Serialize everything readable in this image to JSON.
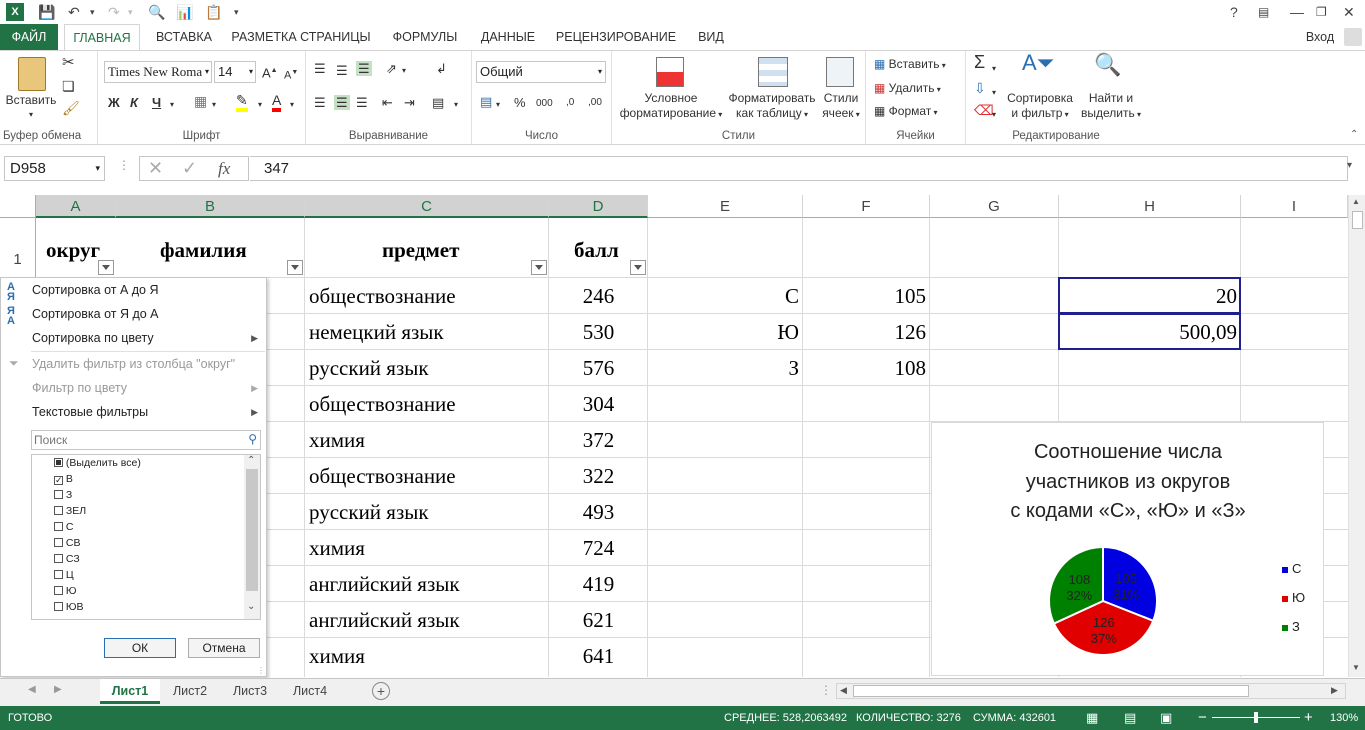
{
  "window": {
    "help": "?",
    "signin": "Вход"
  },
  "tabs": [
    "ФАЙЛ",
    "ГЛАВНАЯ",
    "ВСТАВКА",
    "РАЗМЕТКА СТРАНИЦЫ",
    "ФОРМУЛЫ",
    "ДАННЫЕ",
    "РЕЦЕНЗИРОВАНИЕ",
    "ВИД"
  ],
  "ribbon": {
    "clipboard": {
      "label": "Буфер обмена",
      "paste": "Вставить"
    },
    "font": {
      "label": "Шрифт",
      "name": "Times New Roma",
      "size": "14",
      "bold": "Ж",
      "italic": "К",
      "underline": "Ч"
    },
    "align": {
      "label": "Выравнивание"
    },
    "number": {
      "label": "Число",
      "format": "Общий",
      "percent": "%",
      "thousands": "000"
    },
    "styles": {
      "label": "Стили",
      "cond1": "Условное",
      "cond2": "форматирование",
      "tbl1": "Форматировать",
      "tbl2": "как таблицу",
      "cs1": "Стили",
      "cs2": "ячеек"
    },
    "cells": {
      "label": "Ячейки",
      "insert": "Вставить",
      "delete": "Удалить",
      "format": "Формат"
    },
    "editing": {
      "label": "Редактирование",
      "sort1": "Сортировка",
      "sort2": "и фильтр",
      "find1": "Найти и",
      "find2": "выделить"
    }
  },
  "formula": {
    "namebox": "D958",
    "value": "347"
  },
  "columns": [
    "A",
    "B",
    "C",
    "D",
    "E",
    "F",
    "G",
    "H",
    "I"
  ],
  "header_row": {
    "rownum": "1",
    "a": "округ",
    "b": "фамилия",
    "c": "предмет",
    "d": "балл"
  },
  "rows": [
    {
      "c": "обществознание",
      "d": "246"
    },
    {
      "c": "немецкий язык",
      "d": "530"
    },
    {
      "c": "русский язык",
      "d": "576"
    },
    {
      "c": "обществознание",
      "d": "304"
    },
    {
      "c": "химия",
      "d": "372"
    },
    {
      "c": "обществознание",
      "d": "322"
    },
    {
      "c": "русский язык",
      "d": "493"
    },
    {
      "c": "химия",
      "d": "724"
    },
    {
      "c": "английский язык",
      "d": "419"
    },
    {
      "c": "английский язык",
      "d": "621"
    },
    {
      "c": "химия",
      "d": "641"
    }
  ],
  "summary": [
    {
      "e": "С",
      "f": "105",
      "h": "20"
    },
    {
      "e": "Ю",
      "f": "126",
      "h": "500,09"
    },
    {
      "e": "З",
      "f": "108",
      "h": ""
    }
  ],
  "filter_menu": {
    "sort_az": "Сортировка от А до Я",
    "sort_za": "Сортировка от Я до А",
    "sort_color": "Сортировка по цвету",
    "clear": "Удалить фильтр из столбца \"округ\"",
    "by_color": "Фильтр по цвету",
    "text_filters": "Текстовые фильтры",
    "search_placeholder": "Поиск",
    "items": [
      {
        "label": "(Выделить все)",
        "state": "partial"
      },
      {
        "label": "В",
        "state": "checked"
      },
      {
        "label": "З",
        "state": "unchecked"
      },
      {
        "label": "ЗЕЛ",
        "state": "unchecked"
      },
      {
        "label": "С",
        "state": "unchecked"
      },
      {
        "label": "СВ",
        "state": "unchecked"
      },
      {
        "label": "СЗ",
        "state": "unchecked"
      },
      {
        "label": "Ц",
        "state": "unchecked"
      },
      {
        "label": "Ю",
        "state": "unchecked"
      },
      {
        "label": "ЮВ",
        "state": "unchecked"
      }
    ],
    "ok": "ОК",
    "cancel": "Отмена"
  },
  "chart_data": {
    "type": "pie",
    "title": "Соотношение числа участников из округов с кодами «С», «Ю» и «З»",
    "title_lines": [
      "Соотношение числа",
      "участников из округов",
      "с кодами «С», «Ю» и «З»"
    ],
    "categories": [
      "С",
      "Ю",
      "З"
    ],
    "values": [
      105,
      126,
      108
    ],
    "percent_labels": [
      "31%",
      "37%",
      "32%"
    ],
    "colors": [
      "#0000e0",
      "#e00000",
      "#008000"
    ],
    "legend": "right"
  },
  "sheets": [
    "Лист1",
    "Лист2",
    "Лист3",
    "Лист4"
  ],
  "status": {
    "ready": "ГОТОВО",
    "avg": "СРЕДНЕЕ: 528,2063492",
    "count": "КОЛИЧЕСТВО: 3276",
    "sum": "СУММА: 432601",
    "zoom": "130%"
  },
  "colors": {
    "accent": "#217346",
    "selection": "#1f1f8f"
  }
}
